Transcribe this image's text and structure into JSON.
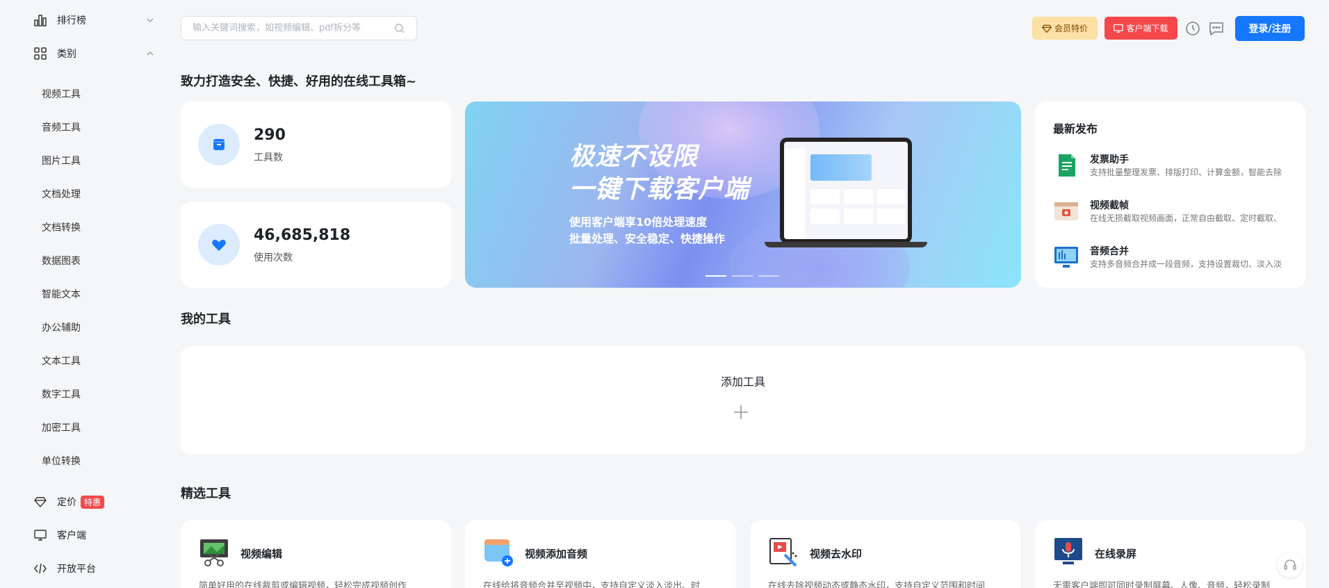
{
  "sidebar": {
    "ranking": "排行榜",
    "category": "类别",
    "categories": [
      "视频工具",
      "音频工具",
      "图片工具",
      "文档处理",
      "文档转换",
      "数据图表",
      "智能文本",
      "办公辅助",
      "文本工具",
      "数字工具",
      "加密工具",
      "单位转换"
    ],
    "pricing": "定价",
    "pricing_badge": "特惠",
    "client": "客户端",
    "open_platform": "开放平台"
  },
  "search": {
    "placeholder": "输入关键词搜索，如视频编辑、pdf拆分等",
    "value": ""
  },
  "header": {
    "vip_label": "会员特价",
    "download_label": "客户端下载",
    "login_label": "登录/注册"
  },
  "tagline": "致力打造安全、快捷、好用的在线工具箱~",
  "stats": [
    {
      "value": "290",
      "label": "工具数"
    },
    {
      "value": "46,685,818",
      "label": "使用次数"
    }
  ],
  "banner": {
    "line1": "极速不设限",
    "line2": "一键下载客户端",
    "sub1": "使用客户端享10倍处理速度",
    "sub2": "批量处理、安全稳定、快捷操作",
    "slide_count": 3,
    "active_slide": 1
  },
  "latest": {
    "title": "最新发布",
    "items": [
      {
        "name": "发票助手",
        "desc": "支持批量整理发票、排版打印、计算金额，智能去除"
      },
      {
        "name": "视频截帧",
        "desc": "在线无损截取视频画面，正常自由截取、定时截取、"
      },
      {
        "name": "音频合并",
        "desc": "支持多音频合并成一段音频，支持设置裁切、淡入淡"
      }
    ]
  },
  "my_tools": {
    "title": "我的工具",
    "add_label": "添加工具"
  },
  "featured": {
    "title": "精选工具",
    "tools": [
      {
        "name": "视频编辑",
        "desc": "简单好用的在线裁剪或编辑视频，轻松完成视频创作"
      },
      {
        "name": "视频添加音频",
        "desc": "在线给将音频合并至视频中，支持自定义淡入淡出、时"
      },
      {
        "name": "视频去水印",
        "desc": "在线去除视频动态或静态水印，支持自定义范围和时间"
      },
      {
        "name": "在线录屏",
        "desc": "无需客户端即可同时录制屏幕、人像、音频，轻松录制"
      }
    ]
  },
  "colors": {
    "primary": "#1677ff",
    "danger": "#f5484b",
    "vip_bg": "#fde0a4"
  }
}
